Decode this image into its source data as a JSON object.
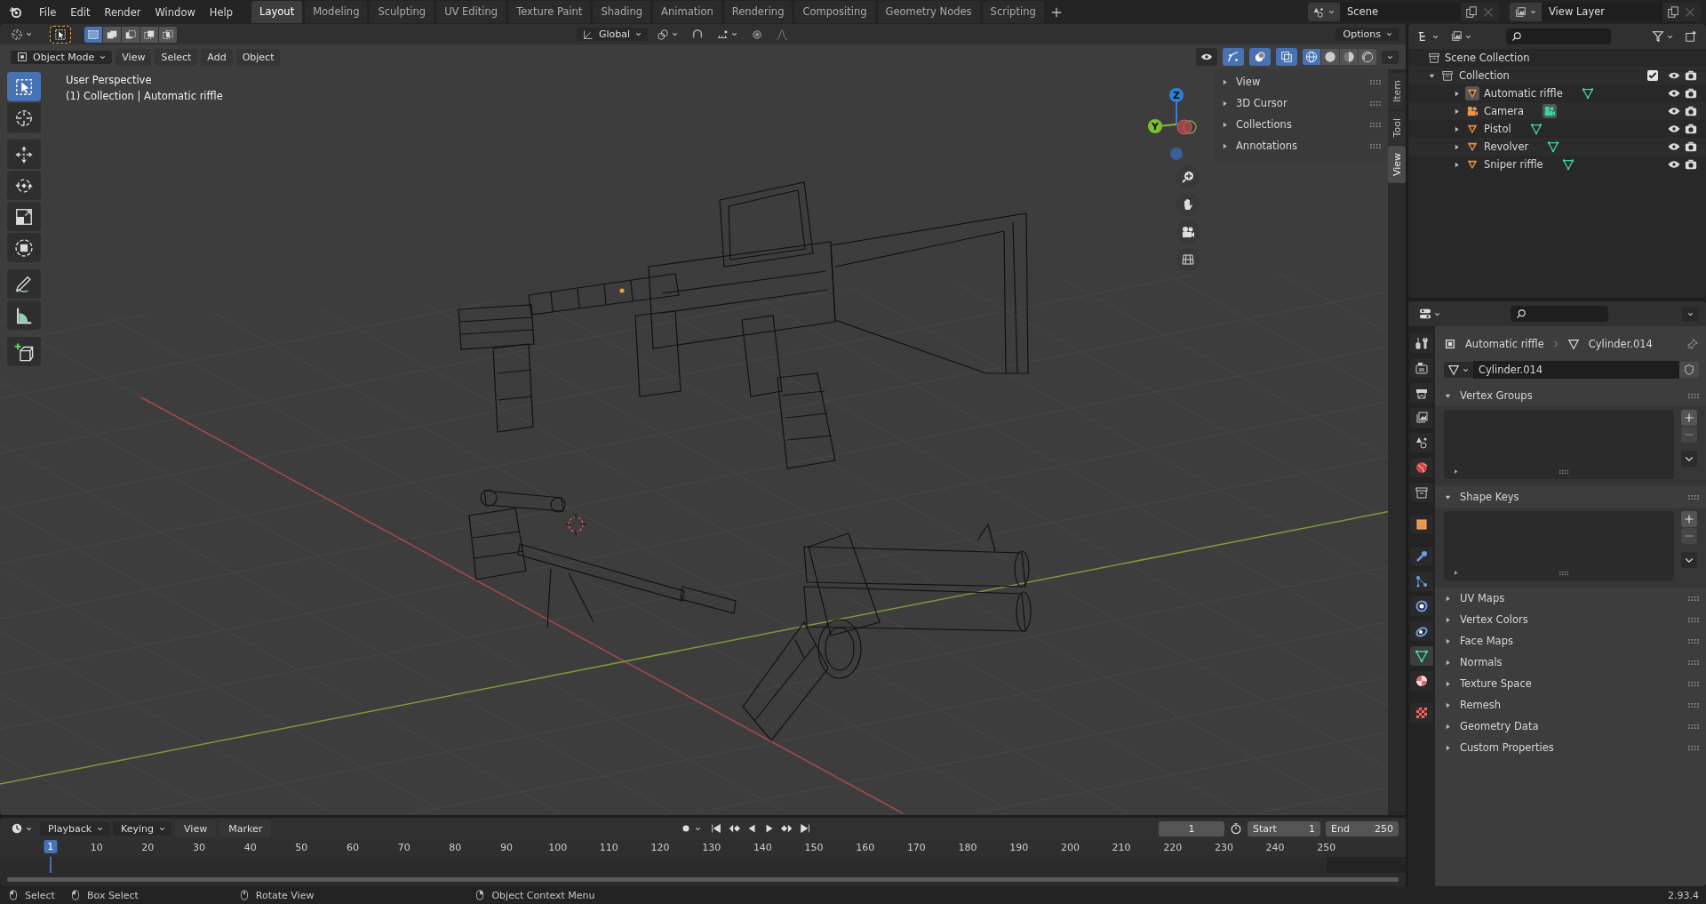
{
  "top_bar": {
    "menus": [
      "File",
      "Edit",
      "Render",
      "Window",
      "Help"
    ],
    "workspaces": [
      {
        "label": "Layout",
        "selected": true
      },
      {
        "label": "Modeling",
        "selected": false
      },
      {
        "label": "Sculpting",
        "selected": false
      },
      {
        "label": "UV Editing",
        "selected": false
      },
      {
        "label": "Texture Paint",
        "selected": false
      },
      {
        "label": "Shading",
        "selected": false
      },
      {
        "label": "Animation",
        "selected": false
      },
      {
        "label": "Rendering",
        "selected": false
      },
      {
        "label": "Compositing",
        "selected": false
      },
      {
        "label": "Geometry Nodes",
        "selected": false
      },
      {
        "label": "Scripting",
        "selected": false
      }
    ],
    "scene": "Scene",
    "view_layer": "View Layer"
  },
  "tool_settings": {
    "select_modes": [
      {
        "kind": "set",
        "selected": true
      },
      {
        "kind": "extend",
        "selected": false
      },
      {
        "kind": "subtract",
        "selected": false
      },
      {
        "kind": "difference",
        "selected": false
      },
      {
        "kind": "intersect",
        "selected": false
      }
    ],
    "orientation": "Global",
    "options": "Options"
  },
  "viewport_header": {
    "mode": "Object Mode",
    "menus": [
      "View",
      "Select",
      "Add",
      "Object"
    ],
    "toggles": [
      {
        "kind": "visibility",
        "on": false
      },
      {
        "kind": "gizmo",
        "on": true
      },
      {
        "kind": "overlay",
        "on": true
      },
      {
        "kind": "xray",
        "on": true
      }
    ],
    "shading": [
      {
        "kind": "wireframe",
        "selected": true
      },
      {
        "kind": "solid",
        "selected": false
      },
      {
        "kind": "material",
        "selected": false
      },
      {
        "kind": "rendered",
        "selected": false
      }
    ]
  },
  "toolbar": [
    {
      "kind": "select",
      "selected": true
    },
    {
      "kind": "cursor",
      "selected": false
    },
    {
      "kind": "move",
      "selected": false
    },
    {
      "kind": "rotate",
      "selected": false
    },
    {
      "kind": "scale",
      "selected": false
    },
    {
      "kind": "transform",
      "selected": false
    },
    {
      "kind": "annotate",
      "selected": false
    },
    {
      "kind": "measure",
      "selected": false
    },
    {
      "kind": "add_cube",
      "selected": false
    }
  ],
  "viewport": {
    "perspective": "User Perspective",
    "context": "(1) Collection | Automatic riffle",
    "gizmo_labels": [
      "Z",
      "Y"
    ]
  },
  "sidebar": {
    "panels": [
      "View",
      "3D Cursor",
      "Collections",
      "Annotations"
    ],
    "tabs": [
      {
        "label": "Item",
        "selected": false
      },
      {
        "label": "Tool",
        "selected": false
      },
      {
        "label": "View",
        "selected": true
      }
    ]
  },
  "outliner": {
    "root": "Scene Collection",
    "collection": {
      "name": "Collection",
      "expanded": true,
      "checked": true,
      "children": [
        {
          "name": "Automatic riffle",
          "kind": "mesh",
          "selected": true,
          "visible": true,
          "renderable": true
        },
        {
          "name": "Camera",
          "kind": "camera",
          "selected": false,
          "visible": true,
          "renderable": true
        },
        {
          "name": "Pistol",
          "kind": "mesh",
          "selected": false,
          "visible": true,
          "renderable": true
        },
        {
          "name": "Revolver",
          "kind": "mesh",
          "selected": false,
          "visible": true,
          "renderable": true
        },
        {
          "name": "Sniper riffle",
          "kind": "mesh",
          "selected": false,
          "visible": true,
          "renderable": true
        }
      ]
    }
  },
  "properties": {
    "object": "Automatic riffle",
    "data": "Cylinder.014",
    "mesh_name": "Cylinder.014",
    "tabs": [
      {
        "kind": "tool",
        "selected": false
      },
      {
        "kind": "render",
        "selected": false
      },
      {
        "kind": "output",
        "selected": false
      },
      {
        "kind": "view_layer",
        "selected": false
      },
      {
        "kind": "scene",
        "selected": false
      },
      {
        "kind": "world",
        "selected": false
      },
      {
        "kind": "collection",
        "selected": false
      },
      {
        "kind": "object",
        "selected": false
      },
      {
        "kind": "modifiers",
        "selected": false
      },
      {
        "kind": "particles",
        "selected": false
      },
      {
        "kind": "physics",
        "selected": false
      },
      {
        "kind": "constraints",
        "selected": false
      },
      {
        "kind": "data",
        "selected": true
      },
      {
        "kind": "material",
        "selected": false
      },
      {
        "kind": "texture",
        "selected": false
      }
    ],
    "panels": [
      {
        "title": "Vertex Groups",
        "expanded": true
      },
      {
        "title": "Shape Keys",
        "expanded": true
      },
      {
        "title": "UV Maps",
        "expanded": false
      },
      {
        "title": "Vertex Colors",
        "expanded": false
      },
      {
        "title": "Face Maps",
        "expanded": false
      },
      {
        "title": "Normals",
        "expanded": false
      },
      {
        "title": "Texture Space",
        "expanded": false
      },
      {
        "title": "Remesh",
        "expanded": false
      },
      {
        "title": "Geometry Data",
        "expanded": false
      },
      {
        "title": "Custom Properties",
        "expanded": false
      }
    ]
  },
  "timeline": {
    "menus": [
      "Playback",
      "Keying",
      "View",
      "Marker"
    ],
    "current_frame": "1",
    "start_label": "Start",
    "start": "1",
    "end_label": "End",
    "end": "250",
    "playhead": "1",
    "ticks": [
      "10",
      "20",
      "30",
      "40",
      "50",
      "60",
      "70",
      "80",
      "90",
      "100",
      "110",
      "120",
      "130",
      "140",
      "150",
      "160",
      "170",
      "180",
      "190",
      "200",
      "210",
      "220",
      "230",
      "240",
      "250"
    ]
  },
  "status_bar": {
    "hints": [
      "Select",
      "Box Select",
      "Rotate View",
      "Object Context Menu"
    ],
    "version": "2.93.4"
  }
}
